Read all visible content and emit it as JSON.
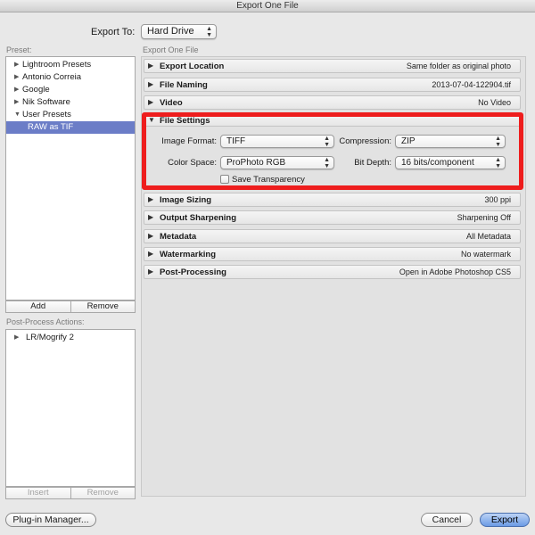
{
  "window": {
    "title": "Export One File"
  },
  "export_to": {
    "label": "Export To:",
    "value": "Hard Drive"
  },
  "preset": {
    "section_label": "Preset:",
    "items": [
      {
        "label": "Lightroom Presets"
      },
      {
        "label": "Antonio Correia"
      },
      {
        "label": "Google"
      },
      {
        "label": "Nik Software"
      },
      {
        "label": "User Presets"
      },
      {
        "label": "RAW as TIF"
      }
    ],
    "add_label": "Add",
    "remove_label": "Remove"
  },
  "post_process": {
    "section_label": "Post-Process Actions:",
    "items": [
      {
        "label": "LR/Mogrify 2"
      }
    ],
    "insert_label": "Insert",
    "remove_label": "Remove"
  },
  "main": {
    "section_label": "Export One File",
    "sections": [
      {
        "title": "Export Location",
        "summary": "Same folder as original photo"
      },
      {
        "title": "File Naming",
        "summary": "2013-07-04-122904.tif"
      },
      {
        "title": "Video",
        "summary": "No Video"
      },
      {
        "title": "File Settings",
        "summary": ""
      },
      {
        "title": "Image Sizing",
        "summary": "300 ppi"
      },
      {
        "title": "Output Sharpening",
        "summary": "Sharpening Off"
      },
      {
        "title": "Metadata",
        "summary": "All Metadata"
      },
      {
        "title": "Watermarking",
        "summary": "No watermark"
      },
      {
        "title": "Post-Processing",
        "summary": "Open in Adobe Photoshop CS5"
      }
    ],
    "file_settings": {
      "image_format_label": "Image Format:",
      "image_format_value": "TIFF",
      "compression_label": "Compression:",
      "compression_value": "ZIP",
      "color_space_label": "Color Space:",
      "color_space_value": "ProPhoto RGB",
      "bit_depth_label": "Bit Depth:",
      "bit_depth_value": "16 bits/component",
      "transparency_label": "Save Transparency"
    }
  },
  "footer": {
    "plugin_manager_label": "Plug-in Manager...",
    "cancel_label": "Cancel",
    "export_label": "Export"
  },
  "colors": {
    "highlight": "#ee1d1d",
    "selection": "#6b7dc7",
    "primary_button": "#6b9be5"
  }
}
